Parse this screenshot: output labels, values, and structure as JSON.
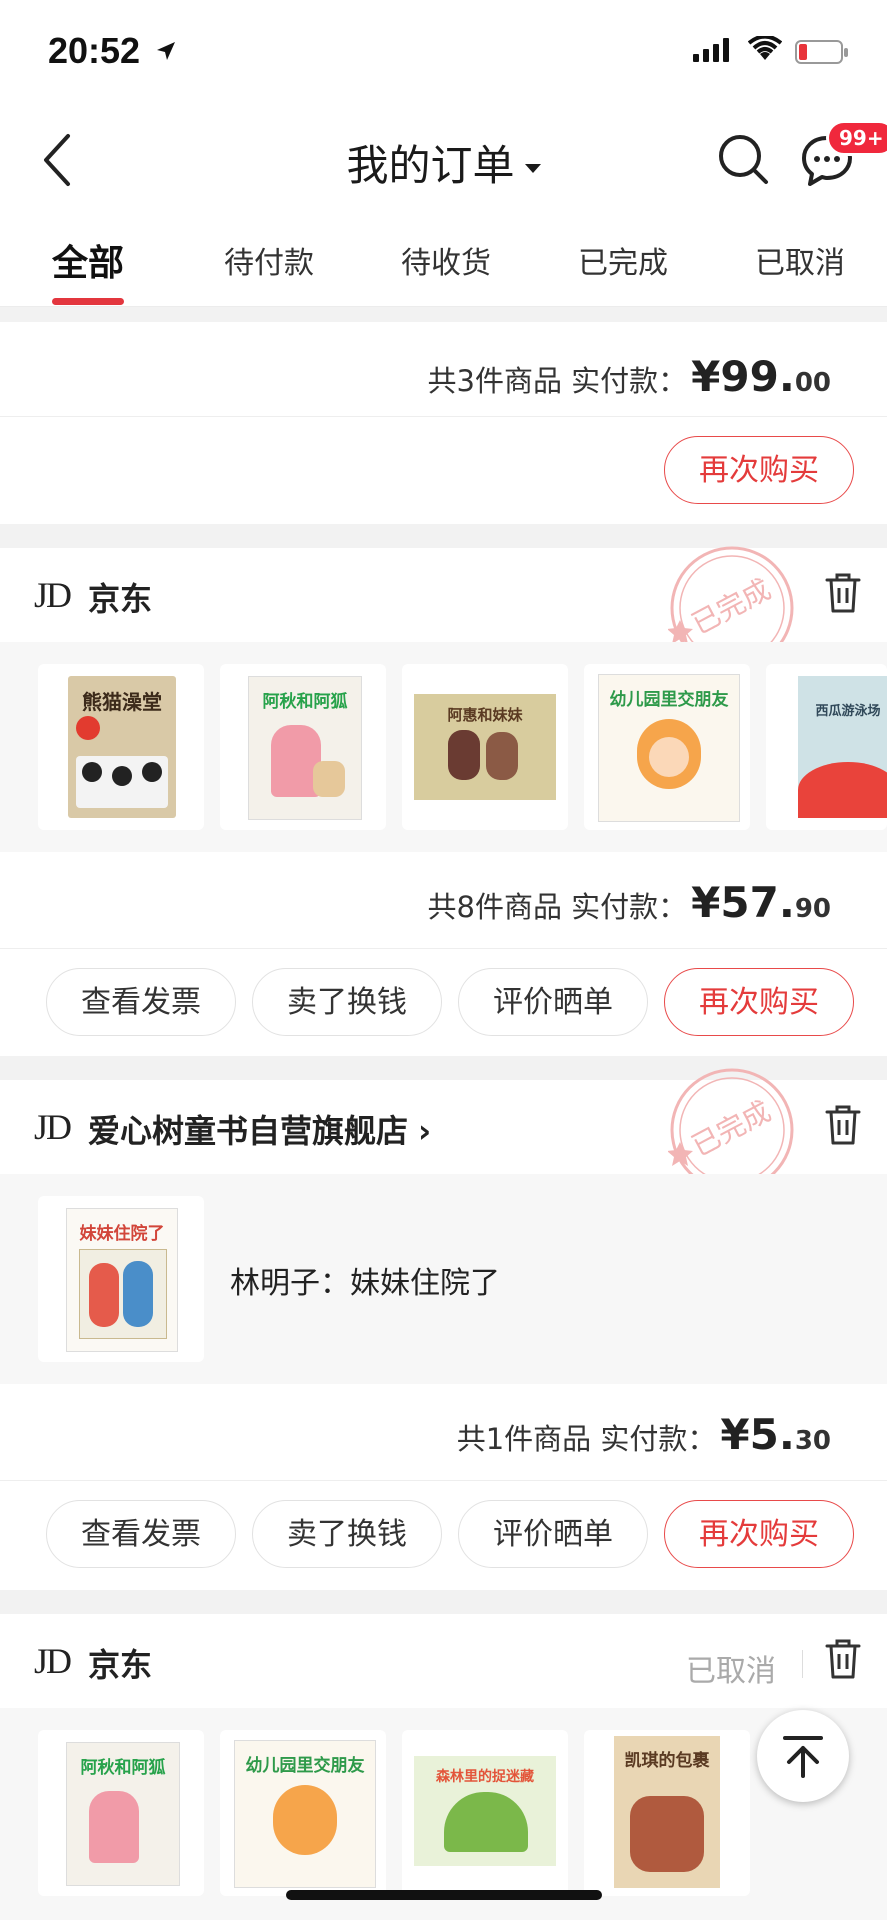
{
  "status_bar": {
    "time": "20:52"
  },
  "nav": {
    "title": "我的订单",
    "badge": "99+"
  },
  "tabs": [
    "全部",
    "待付款",
    "待收货",
    "已完成",
    "已取消"
  ],
  "order0": {
    "summary_label": "共3件商品  实付款：",
    "amount": "¥99.",
    "cents": "00",
    "buttons": [
      "再次购买"
    ]
  },
  "order1": {
    "shop": "京东",
    "stamp": "已完成",
    "goods": [
      "熊猫澡堂",
      "阿秋和阿狐",
      "阿惠和妹妹",
      "幼儿园里交朋友",
      "西瓜游泳场"
    ],
    "summary_label": "共8件商品  实付款：",
    "amount": "¥57.",
    "cents": "90",
    "buttons": [
      "查看发票",
      "卖了换钱",
      "评价晒单",
      "再次购买"
    ]
  },
  "order2": {
    "shop": "爱心树童书自营旗舰店",
    "stamp": "已完成",
    "goods_cover": "妹妹住院了",
    "goods_name": "林明子：妹妹住院了",
    "summary_label": "共1件商品  实付款：",
    "amount": "¥5.",
    "cents": "30",
    "buttons": [
      "查看发票",
      "卖了换钱",
      "评价晒单",
      "再次购买"
    ]
  },
  "order3": {
    "shop": "京东",
    "status": "已取消",
    "goods": [
      "阿秋和阿狐",
      "幼儿园里交朋友",
      "森林里的捉迷藏",
      "凯琪的包裹"
    ]
  },
  "colors": {
    "accent": "#e3363e",
    "stamp": "#f2b5b5",
    "badge": "#f0283c"
  }
}
